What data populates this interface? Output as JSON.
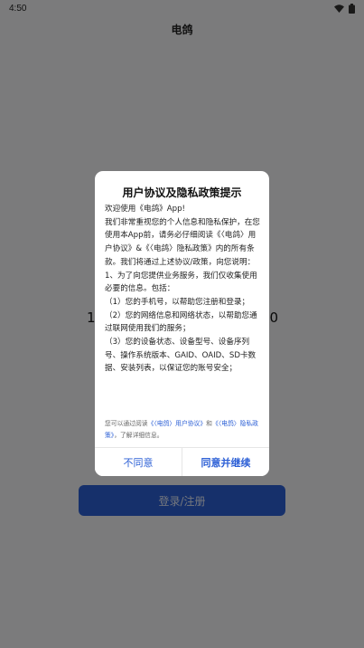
{
  "status_bar": {
    "time": "4:50",
    "wifi_icon": "wifi-icon",
    "battery_icon": "battery-icon"
  },
  "header": {
    "title": "电鸽"
  },
  "page": {
    "phone_first": "1",
    "phone_last": "0",
    "login_button": "登录/注册"
  },
  "dialog": {
    "title": "用户协议及隐私政策提示",
    "paragraphs": [
      "欢迎使用《电鸽》App!",
      "我们非常重视您的个人信息和隐私保护，在您使用本App前，请务必仔细阅读《〈电鸽〉用户协议》&《〈电鸽〉隐私政策》内的所有条款。我们将通过上述协议/政策，向您说明：",
      "1、为了向您提供业务服务，我们仅收集使用必要的信息。包括：",
      "（1）您的手机号，以帮助您注册和登录；",
      "（2）您的网络信息和网络状态，以帮助您通过联网使用我们的服务；",
      "（3）您的设备状态、设备型号、设备序列号、操作系统版本、GAID、OAID、SD卡数据、安装列表，以保证您的账号安全；"
    ],
    "footer_prefix": "您可以通过阅读",
    "footer_link_1": "《〈电鸽〉用户协议》",
    "footer_and": "和",
    "footer_link_2": "《〈电鸽〉隐私政策》",
    "footer_suffix": "，了解详细信息。",
    "disagree_label": "不同意",
    "agree_label": "同意并继续"
  },
  "colors": {
    "accent": "#2d60d6",
    "scrim": "rgba(0,0,0,0.5)"
  }
}
